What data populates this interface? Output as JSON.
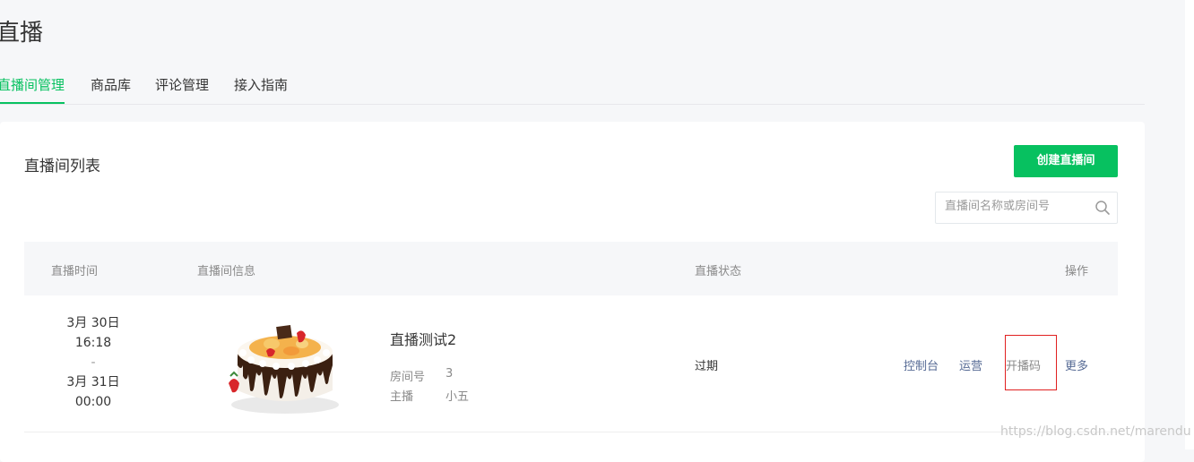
{
  "header": {
    "title": "直播"
  },
  "tabs": [
    {
      "label": "直播间管理",
      "active": true
    },
    {
      "label": "商品库",
      "active": false
    },
    {
      "label": "评论管理",
      "active": false
    },
    {
      "label": "接入指南",
      "active": false
    }
  ],
  "card": {
    "title": "直播间列表",
    "create_button": "创建直播间",
    "search": {
      "placeholder": "直播间名称或房间号",
      "value": "",
      "icon": "search-icon"
    }
  },
  "table": {
    "headers": [
      "直播时间",
      "直播间信息",
      "直播状态",
      "操作"
    ],
    "rows": [
      {
        "time": {
          "start_date": "3月 30日",
          "start_time": "16:18",
          "separator": "-",
          "end_date": "3月 31日",
          "end_time": "00:00"
        },
        "cover_icon": "cake-image",
        "name": "直播测试2",
        "room_label": "房间号",
        "room_value": "3",
        "host_label": "主播",
        "host_value": "小五",
        "status": "过期",
        "actions": [
          "控制台",
          "运营",
          "开播码",
          "更多"
        ]
      }
    ]
  },
  "watermark": "https://blog.csdn.net/marendu",
  "colors": {
    "accent": "#07c160",
    "link": "#576b95",
    "highlight": "#e02020"
  }
}
